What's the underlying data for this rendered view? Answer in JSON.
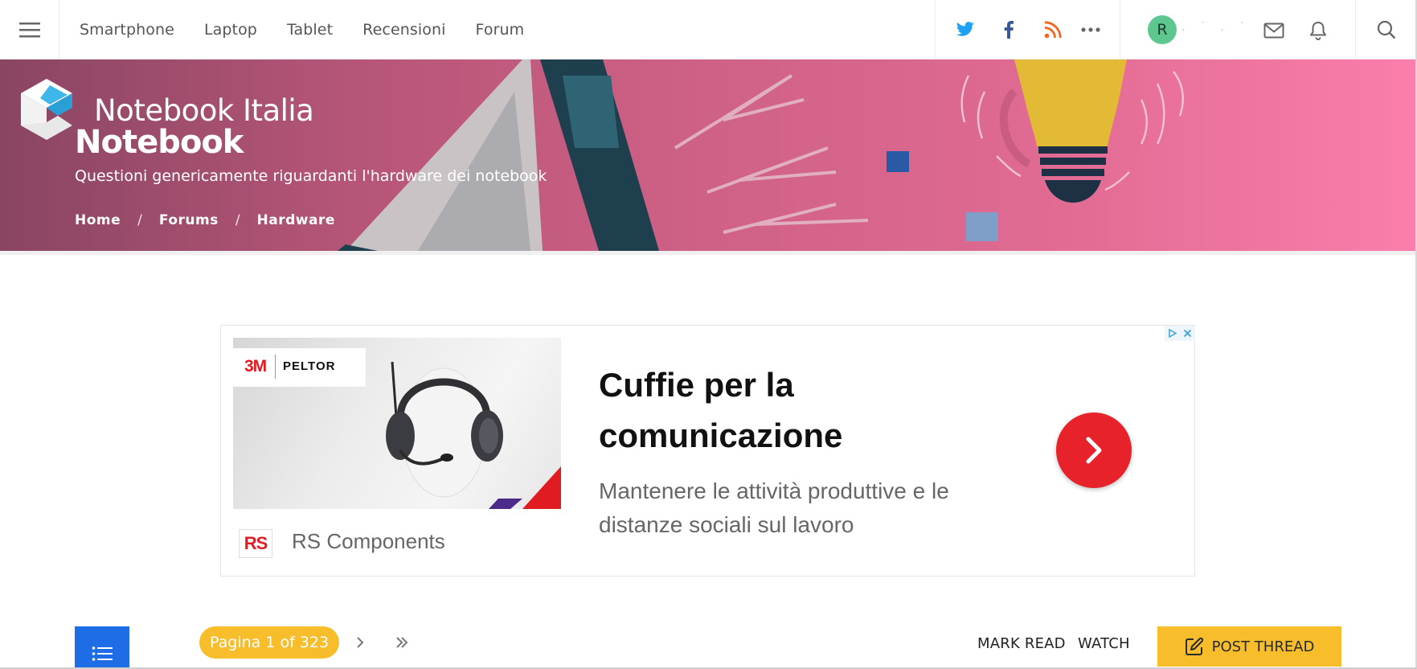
{
  "header": {
    "nav": [
      "Smartphone",
      "Laptop",
      "Tablet",
      "Recensioni",
      "Forum"
    ],
    "user": {
      "avatar_letter": "R",
      "name": ". ˙ . ˙"
    },
    "icons": [
      "menu-icon",
      "twitter-icon",
      "facebook-icon",
      "rss-icon",
      "more-icon",
      "mail-icon",
      "bell-icon",
      "search-icon"
    ],
    "colors": {
      "twitter": "#1da1f2",
      "facebook": "#3b5998",
      "rss": "#f26522",
      "avatar": "#5dc78f"
    }
  },
  "banner": {
    "site_name": "Notebook Italia",
    "forum_title": "Notebook",
    "description": "Questioni genericamente riguardanti l'hardware dei notebook",
    "breadcrumb": [
      "Home",
      "Forums",
      "Hardware"
    ],
    "breadcrumb_separator": "/"
  },
  "ad": {
    "image_brand_left": "3M",
    "image_brand_right": "PELTOR",
    "headline": "Cuffie per la comunicazione",
    "body": "Mantenere le attività produttive e le distanze sociali sul lavoro",
    "advertiser_logo": "RS",
    "advertiser": "RS Components",
    "arrow_color": "#e8222a"
  },
  "controls": {
    "pagination": "Pagina 1 of 323",
    "mark_read": "MARK READ",
    "watch": "WATCH",
    "post_thread": "POST THREAD",
    "accent": "#f7bd2b",
    "list_button_color": "#1e6de6"
  }
}
